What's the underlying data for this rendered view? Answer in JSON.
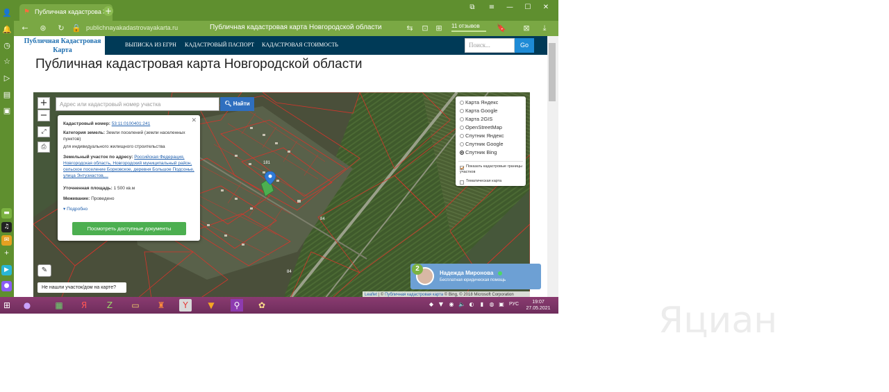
{
  "browser": {
    "tab_title": "Публичная кадастрова",
    "url": "publichnayakadastrovayakarta.ru",
    "page_title": "Публичная кадастровая карта Новгородской области",
    "reviews": "11 отзывов"
  },
  "site": {
    "logo_line1": "Публичная Кадастровая",
    "logo_line2": "Карта",
    "nav": [
      "ВЫПИСКА ИЗ ЕГРН",
      "КАДАСТРОВЫЙ ПАСПОРТ",
      "КАДАСТРОВАЯ СТОИМОСТЬ"
    ],
    "search_placeholder": "Поиск...",
    "search_button": "Go",
    "heading": "Публичная кадастровая карта Новгородской области"
  },
  "map": {
    "zoom_in": "+",
    "zoom_out": "−",
    "search_placeholder": "Адрес или кадастровый номер участка",
    "find_button": "Найти",
    "popup": {
      "cadastral_label": "Кадастровый номер:",
      "cadastral_value": "53:11:0100401:241",
      "category_label": "Категория земель:",
      "category_value": "Земли поселений (земли населенных пунктов)",
      "use": "для индивидуального жилищного строительства",
      "address_label": "Земельный участок по адресу:",
      "address_value": "Российская Федерация, Новгородская область, Новгородский муниципальный район, сельское поселение Борковское, деревня Большое Подсонье, улица Энтузиастов,...",
      "area_label": "Уточненная площадь:",
      "area_value": "1 500 кв.м",
      "survey_label": "Межевание:",
      "survey_value": "Проведено",
      "more": "Подробно",
      "docs_button": "Посмотреть доступные документы"
    },
    "layers": [
      {
        "label": "Карта Яндекс",
        "selected": false
      },
      {
        "label": "Карта Google",
        "selected": false
      },
      {
        "label": "Карта 2GIS",
        "selected": false
      },
      {
        "label": "OpenStreetMap",
        "selected": false
      },
      {
        "label": "Спутник Яндекс",
        "selected": false
      },
      {
        "label": "Спутник Google",
        "selected": false
      },
      {
        "label": "Спутник Bing",
        "selected": true
      }
    ],
    "checks": [
      {
        "label": "Показать кадастровые границы участков",
        "checked": true
      },
      {
        "label": "Тематическая карта",
        "checked": false
      }
    ],
    "not_found": "Не нашли участок/дом на карте?",
    "attribution_leaflet": "Leaflet",
    "attribution_site": "Публичная кадастровая карта",
    "attribution_rest": "Bing, © 2018 Microsoft Corporation",
    "parcel_labels": [
      "181",
      "84",
      "84"
    ]
  },
  "chat": {
    "badge": "2",
    "name": "Надежда Миронова",
    "subtitle": "Бесплатная юридическая помощь"
  },
  "taskbar": {
    "lang": "РУС",
    "time": "19:07",
    "date": "27.05.2021"
  },
  "watermark": "Яциан",
  "colors": {
    "browser_green": "#5f8f2f",
    "site_nav": "#003a57",
    "docs_button": "#4caf50",
    "find_button": "#2f6fbf",
    "chat_bg": "#6da0d4",
    "taskbar": "#7d3366"
  }
}
